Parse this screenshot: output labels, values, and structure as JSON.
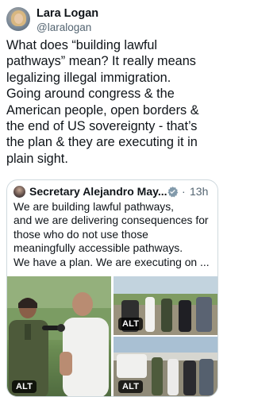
{
  "author": {
    "name": "Lara Logan",
    "handle": "@laralogan"
  },
  "tweet": {
    "text": "What does “building lawful\npathways” mean? It really means\nlegalizing illegal immigration.\nGoing around congress & the\nAmerican people, open borders &\nthe end of US sovereignty - that’s\nthe plan & they are executing it in\nplain sight."
  },
  "quoted": {
    "author_name": "Secretary Alejandro May...",
    "separator": "·",
    "time": "13h",
    "text": "We are building lawful pathways,\nand we are delivering consequences for\nthose who do not use those\nmeaningfully accessible pathways.\nWe have a plan. We are executing on ...",
    "media": [
      {
        "alt_badge": "ALT"
      },
      {
        "alt_badge": "ALT"
      },
      {
        "alt_badge": "ALT"
      }
    ]
  },
  "colors": {
    "text_primary": "#0f1419",
    "text_secondary": "#536471",
    "border": "#cfd9de",
    "verified": "#829aab"
  }
}
